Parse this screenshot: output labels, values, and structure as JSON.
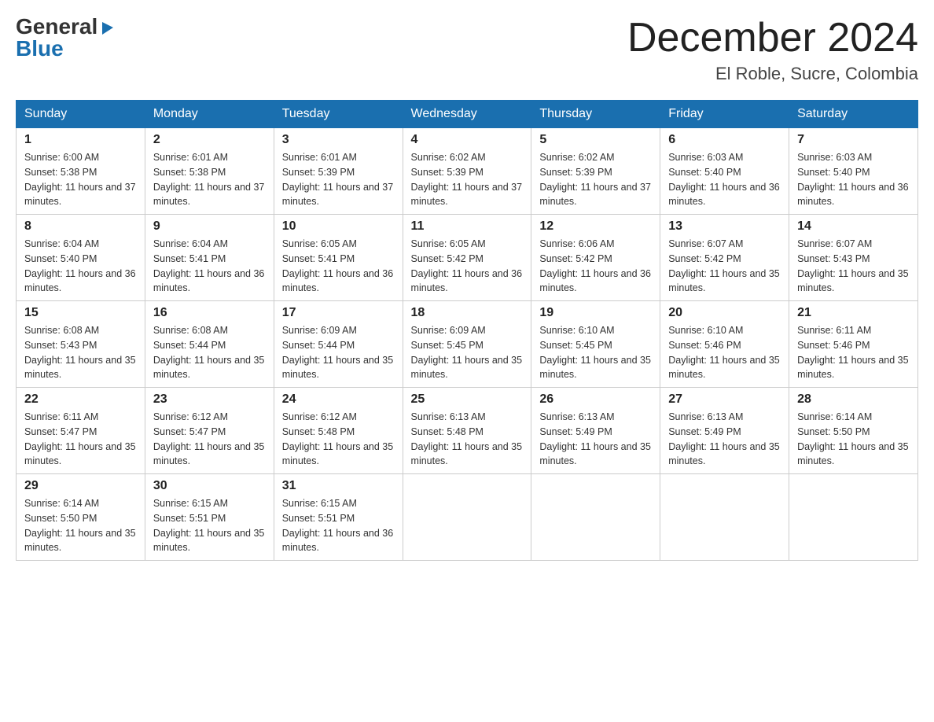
{
  "logo": {
    "general": "General",
    "blue": "Blue",
    "arrow": "▶"
  },
  "title": "December 2024",
  "location": "El Roble, Sucre, Colombia",
  "days_header": [
    "Sunday",
    "Monday",
    "Tuesday",
    "Wednesday",
    "Thursday",
    "Friday",
    "Saturday"
  ],
  "weeks": [
    [
      {
        "day": "1",
        "sunrise": "6:00 AM",
        "sunset": "5:38 PM",
        "daylight": "11 hours and 37 minutes."
      },
      {
        "day": "2",
        "sunrise": "6:01 AM",
        "sunset": "5:38 PM",
        "daylight": "11 hours and 37 minutes."
      },
      {
        "day": "3",
        "sunrise": "6:01 AM",
        "sunset": "5:39 PM",
        "daylight": "11 hours and 37 minutes."
      },
      {
        "day": "4",
        "sunrise": "6:02 AM",
        "sunset": "5:39 PM",
        "daylight": "11 hours and 37 minutes."
      },
      {
        "day": "5",
        "sunrise": "6:02 AM",
        "sunset": "5:39 PM",
        "daylight": "11 hours and 37 minutes."
      },
      {
        "day": "6",
        "sunrise": "6:03 AM",
        "sunset": "5:40 PM",
        "daylight": "11 hours and 36 minutes."
      },
      {
        "day": "7",
        "sunrise": "6:03 AM",
        "sunset": "5:40 PM",
        "daylight": "11 hours and 36 minutes."
      }
    ],
    [
      {
        "day": "8",
        "sunrise": "6:04 AM",
        "sunset": "5:40 PM",
        "daylight": "11 hours and 36 minutes."
      },
      {
        "day": "9",
        "sunrise": "6:04 AM",
        "sunset": "5:41 PM",
        "daylight": "11 hours and 36 minutes."
      },
      {
        "day": "10",
        "sunrise": "6:05 AM",
        "sunset": "5:41 PM",
        "daylight": "11 hours and 36 minutes."
      },
      {
        "day": "11",
        "sunrise": "6:05 AM",
        "sunset": "5:42 PM",
        "daylight": "11 hours and 36 minutes."
      },
      {
        "day": "12",
        "sunrise": "6:06 AM",
        "sunset": "5:42 PM",
        "daylight": "11 hours and 36 minutes."
      },
      {
        "day": "13",
        "sunrise": "6:07 AM",
        "sunset": "5:42 PM",
        "daylight": "11 hours and 35 minutes."
      },
      {
        "day": "14",
        "sunrise": "6:07 AM",
        "sunset": "5:43 PM",
        "daylight": "11 hours and 35 minutes."
      }
    ],
    [
      {
        "day": "15",
        "sunrise": "6:08 AM",
        "sunset": "5:43 PM",
        "daylight": "11 hours and 35 minutes."
      },
      {
        "day": "16",
        "sunrise": "6:08 AM",
        "sunset": "5:44 PM",
        "daylight": "11 hours and 35 minutes."
      },
      {
        "day": "17",
        "sunrise": "6:09 AM",
        "sunset": "5:44 PM",
        "daylight": "11 hours and 35 minutes."
      },
      {
        "day": "18",
        "sunrise": "6:09 AM",
        "sunset": "5:45 PM",
        "daylight": "11 hours and 35 minutes."
      },
      {
        "day": "19",
        "sunrise": "6:10 AM",
        "sunset": "5:45 PM",
        "daylight": "11 hours and 35 minutes."
      },
      {
        "day": "20",
        "sunrise": "6:10 AM",
        "sunset": "5:46 PM",
        "daylight": "11 hours and 35 minutes."
      },
      {
        "day": "21",
        "sunrise": "6:11 AM",
        "sunset": "5:46 PM",
        "daylight": "11 hours and 35 minutes."
      }
    ],
    [
      {
        "day": "22",
        "sunrise": "6:11 AM",
        "sunset": "5:47 PM",
        "daylight": "11 hours and 35 minutes."
      },
      {
        "day": "23",
        "sunrise": "6:12 AM",
        "sunset": "5:47 PM",
        "daylight": "11 hours and 35 minutes."
      },
      {
        "day": "24",
        "sunrise": "6:12 AM",
        "sunset": "5:48 PM",
        "daylight": "11 hours and 35 minutes."
      },
      {
        "day": "25",
        "sunrise": "6:13 AM",
        "sunset": "5:48 PM",
        "daylight": "11 hours and 35 minutes."
      },
      {
        "day": "26",
        "sunrise": "6:13 AM",
        "sunset": "5:49 PM",
        "daylight": "11 hours and 35 minutes."
      },
      {
        "day": "27",
        "sunrise": "6:13 AM",
        "sunset": "5:49 PM",
        "daylight": "11 hours and 35 minutes."
      },
      {
        "day": "28",
        "sunrise": "6:14 AM",
        "sunset": "5:50 PM",
        "daylight": "11 hours and 35 minutes."
      }
    ],
    [
      {
        "day": "29",
        "sunrise": "6:14 AM",
        "sunset": "5:50 PM",
        "daylight": "11 hours and 35 minutes."
      },
      {
        "day": "30",
        "sunrise": "6:15 AM",
        "sunset": "5:51 PM",
        "daylight": "11 hours and 35 minutes."
      },
      {
        "day": "31",
        "sunrise": "6:15 AM",
        "sunset": "5:51 PM",
        "daylight": "11 hours and 36 minutes."
      },
      null,
      null,
      null,
      null
    ]
  ]
}
